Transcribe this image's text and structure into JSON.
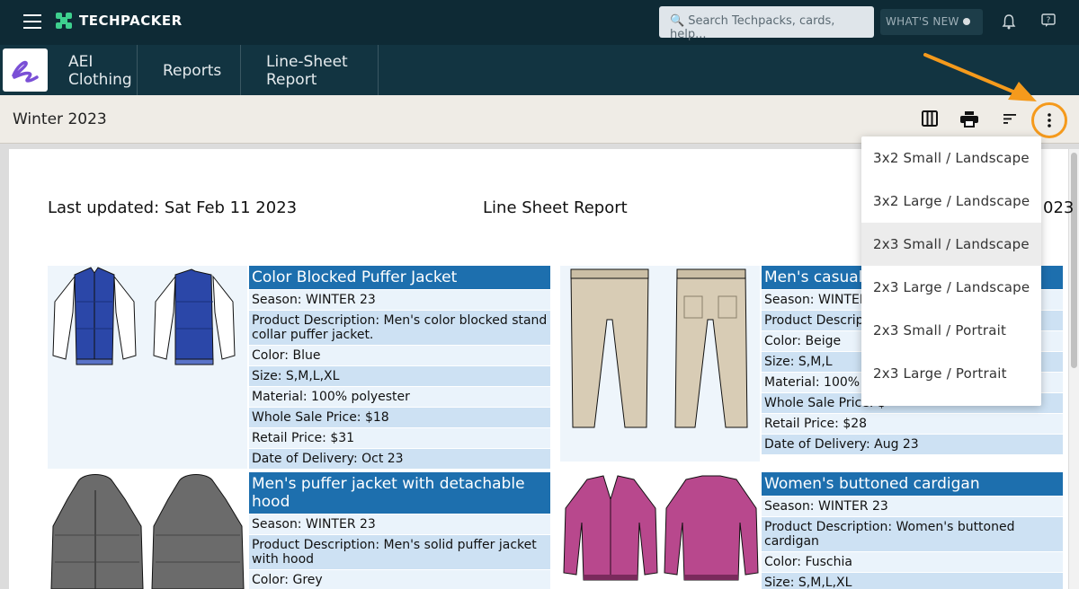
{
  "topbar": {
    "brand": "TECHPACKER",
    "search_placeholder": "Search Techpacks, cards, help...",
    "whats_new": "WHAT'S NEW"
  },
  "nav": {
    "company": "AEI Clothing",
    "reports": "Reports",
    "linesheet": "Line-Sheet Report"
  },
  "subheader": {
    "season": "Winter 2023"
  },
  "report": {
    "last_updated": "Last updated: Sat Feb 11 2023",
    "title": "Line Sheet Report",
    "right_fragment": "023"
  },
  "products": [
    {
      "title": "Color Blocked Puffer Jacket",
      "rows": [
        "Season: WINTER 23",
        "Product Description: Men's color blocked stand collar puffer jacket.",
        "Color: Blue",
        "Size: S,M,L,XL",
        "Material: 100% polyester",
        "Whole Sale Price: $18",
        "Retail Price: $31",
        "Date of Delivery: Oct 23"
      ]
    },
    {
      "title": "Men's casual",
      "rows": [
        "Season: WINTER",
        "Product Descrip",
        "Color: Beige",
        "Size: S,M,L",
        "Material: 100% c",
        "Whole Sale Price: $",
        "Retail Price: $28",
        "Date of Delivery: Aug 23"
      ]
    },
    {
      "title": "Men's puffer jacket with detachable hood",
      "rows": [
        "Season: WINTER 23",
        "Product Description: Men's solid puffer jacket with hood",
        "Color: Grey"
      ]
    },
    {
      "title": "Women's buttoned cardigan",
      "rows": [
        "Season: WINTER 23",
        "Product Description: Women's buttoned cardigan",
        "Color: Fuschia",
        "Size: S,M,L,XL"
      ]
    }
  ],
  "menu": {
    "items": [
      "3x2 Small / Landscape",
      "3x2 Large / Landscape",
      "2x3 Small / Landscape",
      "2x3 Large / Landscape",
      "2x3 Small / Portrait",
      "2x3 Large / Portrait"
    ],
    "highlighted_index": 2
  },
  "colors": {
    "topbar": "#0e2a35",
    "navbar": "#123441",
    "title_bar": "#1d6fae",
    "highlight": "#f59a1c"
  },
  "icons": [
    "hamburger-icon",
    "search-icon",
    "bell-icon",
    "help-icon",
    "columns-icon",
    "print-icon",
    "sort-icon",
    "more-vert-icon"
  ]
}
